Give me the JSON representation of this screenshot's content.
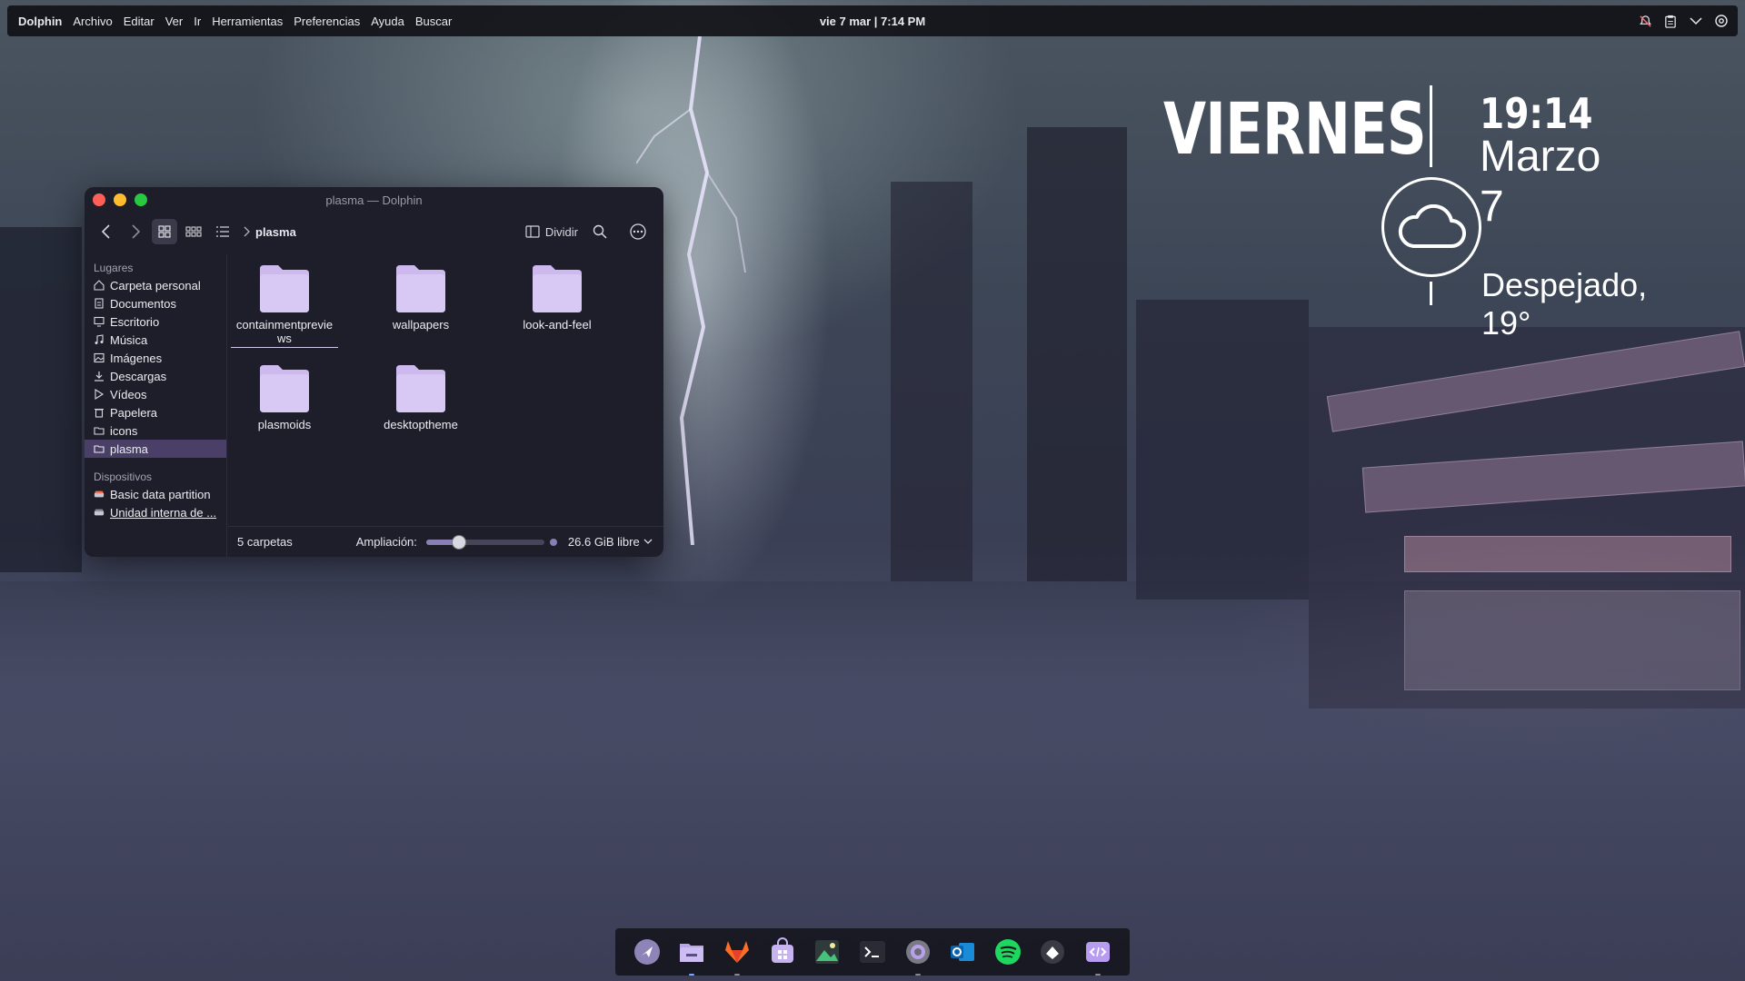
{
  "top_panel": {
    "menu": [
      "Dolphin",
      "Archivo",
      "Editar",
      "Ver",
      "Ir",
      "Herramientas",
      "Preferencias",
      "Ayuda",
      "Buscar"
    ],
    "clock": "vie 7 mar | 7:14 PM",
    "tray_icons": [
      "notifications-off-icon",
      "clipboard-icon",
      "chevron-down-icon",
      "settings-gear-icon"
    ]
  },
  "widget": {
    "day": "VIERNES",
    "time": "19:14",
    "date": "Marzo 7",
    "weather": "Despejado, 19°"
  },
  "window": {
    "title": "plasma — Dolphin",
    "breadcrumb": "plasma",
    "split_label": "Dividir",
    "sidebar": {
      "places_header": "Lugares",
      "places": [
        {
          "label": "Carpeta personal",
          "icon": "home-icon"
        },
        {
          "label": "Documentos",
          "icon": "document-icon"
        },
        {
          "label": "Escritorio",
          "icon": "desktop-icon"
        },
        {
          "label": "Música",
          "icon": "music-icon"
        },
        {
          "label": "Imágenes",
          "icon": "image-icon"
        },
        {
          "label": "Descargas",
          "icon": "download-icon"
        },
        {
          "label": "Vídeos",
          "icon": "video-icon"
        },
        {
          "label": "Papelera",
          "icon": "trash-icon"
        },
        {
          "label": "icons",
          "icon": "folder-icon"
        },
        {
          "label": "plasma",
          "icon": "folder-icon"
        }
      ],
      "devices_header": "Dispositivos",
      "devices": [
        {
          "label": "Basic data partition",
          "icon": "drive-icon"
        },
        {
          "label": "Unidad interna de ...",
          "icon": "drive-icon"
        }
      ]
    },
    "files": [
      "containmentpreviews",
      "wallpapers",
      "look-and-feel",
      "plasmoids",
      "desktoptheme"
    ],
    "file_display": {
      "containmentpreviews": "containmentprevie\nws"
    },
    "status": {
      "count": "5 carpetas",
      "zoom_label": "Ampliación:",
      "zoom_fraction": 0.28,
      "free_space": "26.6 GiB libre"
    }
  },
  "dock": [
    "launcher-icon",
    "files-icon",
    "gitlab-icon",
    "store-icon",
    "image-viewer-icon",
    "terminal-icon",
    "settings-icon",
    "outlook-icon",
    "spotify-icon",
    "editor-icon",
    "code-icon"
  ],
  "colors": {
    "folder": "#cdb9ee",
    "selection": "#4a3f66",
    "window_bg": "#1e1e2a"
  }
}
